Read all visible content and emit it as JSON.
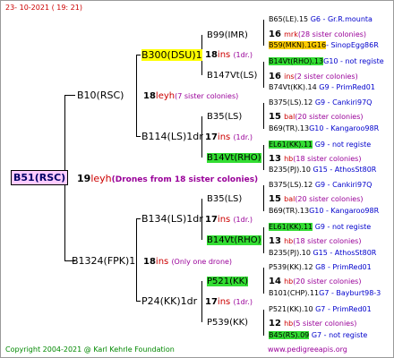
{
  "header_date": "23- 10-2021 ( 19: 21)",
  "footer": {
    "copyright": "Copyright 2004-2021 @ Karl Kehrle Foundation",
    "site": "www.pedigreeapis.org"
  },
  "root": {
    "label": "B51(RSC)",
    "num": "19",
    "suffix": "leyh",
    "note": "(Drones from 18 sister colonies)"
  },
  "gen1": [
    {
      "label": "B10(RSC)",
      "num": "18",
      "suffix": "leyh",
      "note": "(7 sister colonies)"
    },
    {
      "label": "B1324(FPK)1",
      "num": "18",
      "suffix": "ins",
      "note": "(Only one drone)"
    }
  ],
  "gen2": [
    {
      "label": "B300(DSU)1",
      "num": "18",
      "suffix": "ins",
      "note": "(1dr.)"
    },
    {
      "label": "B114(LS)1dr",
      "num": "17",
      "suffix": "ins",
      "note": "(1dr.)"
    },
    {
      "label": "B134(LS)1dr",
      "num": "17",
      "suffix": "ins",
      "note": "(1dr.)"
    },
    {
      "label": "P24(KK)1dr",
      "num": "17",
      "suffix": "ins",
      "note": "(1dr.)"
    }
  ],
  "gen3": [
    {
      "label": "B99(IMR)",
      "num": "16",
      "suffix": "mrk",
      "note": "(28 sister colonies)"
    },
    {
      "label": "B147Vt(LS)",
      "num": "16",
      "suffix": "ins",
      "note": "(2 sister colonies)"
    },
    {
      "label": "B35(LS)",
      "num": "15",
      "suffix": "bal",
      "note": "(20 sister colonies)"
    },
    {
      "label": "B14Vt(RHO)",
      "num": "13",
      "suffix": "hb",
      "note": "(18 sister colonies)"
    },
    {
      "label": "B35(LS)",
      "num": "15",
      "suffix": "bal",
      "note": "(20 sister colonies)"
    },
    {
      "label": "B14Vt(RHO)",
      "num": "13",
      "suffix": "hb",
      "note": "(18 sister colonies)"
    },
    {
      "label": "P521(KK)",
      "num": "14",
      "suffix": "hb",
      "note": "(20 sister colonies)"
    },
    {
      "label": "P539(KK)",
      "num": "12",
      "suffix": "hb",
      "note": "(5 sister colonies)"
    }
  ],
  "gen4": [
    {
      "label": "B65(LE).15",
      "info": "G6 - Gr.R.mounta"
    },
    {
      "label": "B59(MKN).1G16",
      "info": "- SinopEgg86R"
    },
    {
      "label": "B14Vt(RHO).13",
      "info": "G10 - not registe"
    },
    {
      "label": "B74Vt(KK).14",
      "info": "G9 - PrimRed01"
    },
    {
      "label": "B375(LS).12",
      "info": "G9 - Cankiri97Q"
    },
    {
      "label": "B69(TR).13",
      "info": "G10 - Kangaroo98R"
    },
    {
      "label": "EL61(KK).11",
      "info": "G9 - not registe"
    },
    {
      "label": "B235(PJ).10",
      "info": "G15 - AthosSt80R"
    },
    {
      "label": "B375(LS).12",
      "info": "G9 - Cankiri97Q"
    },
    {
      "label": "B69(TR).13",
      "info": "G10 - Kangaroo98R"
    },
    {
      "label": "EL61(KK).11",
      "info": "G9 - not registe"
    },
    {
      "label": "B235(PJ).10",
      "info": "G15 - AthosSt80R"
    },
    {
      "label": "P539(KK).12",
      "info": "G8 - PrimRed01"
    },
    {
      "label": "B101(CHP).11",
      "info": "G7 - Bayburt98-3"
    },
    {
      "label": "P521(KK).10",
      "info": "G7 - PrimRed01"
    },
    {
      "label": "B45(RS).09",
      "info": "G7 - not registe"
    }
  ],
  "colors": {
    "root_bg": "#ffccff",
    "yellow": "#ffff00",
    "green": "#33dd33",
    "orange": "#ffcc00",
    "info_blue": "#0000cc",
    "red": "#cc0000"
  }
}
